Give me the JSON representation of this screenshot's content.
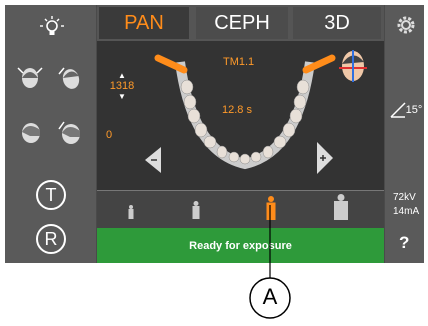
{
  "tabs": [
    {
      "label": "PAN",
      "active": true
    },
    {
      "label": "CEPH",
      "active": false
    },
    {
      "label": "3D",
      "active": false
    }
  ],
  "exposure": {
    "program": "TM1.1",
    "time": "12.8 s",
    "height_value": "1318",
    "position_value": "0"
  },
  "angle": "15°",
  "kv": "72kV",
  "ma": "14mA",
  "status": "Ready for exposure",
  "callout": "A",
  "help": "?",
  "buttons": {
    "t_label": "T",
    "r_label": "R"
  },
  "colors": {
    "accent": "#ff8c1a",
    "status_green": "#2e9a3a"
  },
  "icons": [
    "lamp-icon",
    "head-front-icon",
    "head-tilt-icon",
    "head-side-icon",
    "head-side-tilt-icon",
    "gear-icon",
    "angle-icon",
    "patient-head-icon",
    "patient-child-icon",
    "patient-small-icon",
    "patient-adult-icon",
    "patient-large-icon"
  ]
}
